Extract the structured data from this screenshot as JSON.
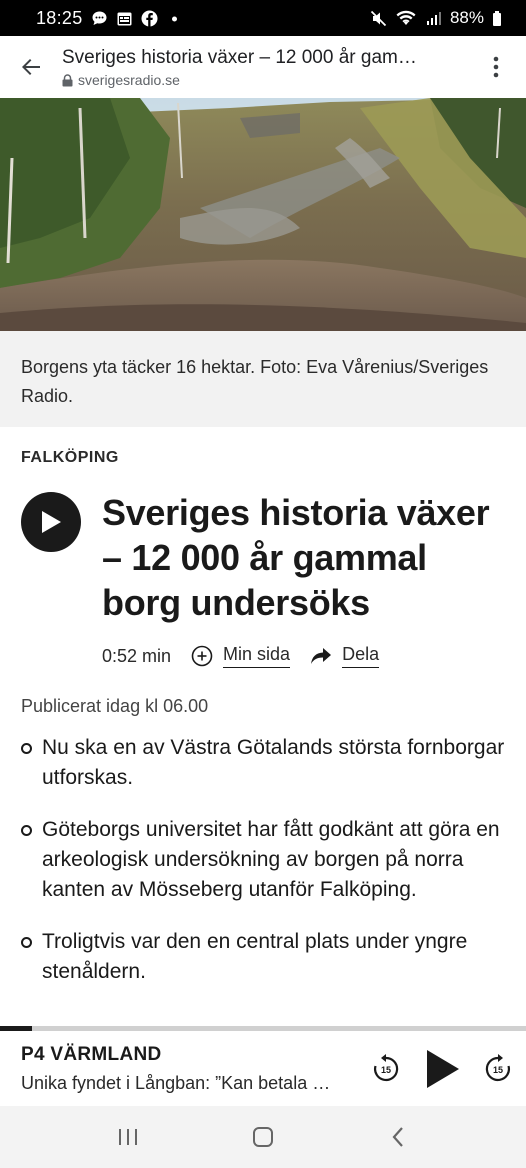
{
  "status_bar": {
    "time": "18:25",
    "battery": "88%",
    "icons": [
      "chat-bubble-icon",
      "calendar-icon",
      "facebook-icon",
      "dot-icon",
      "mute-icon",
      "wifi-icon",
      "signal-icon",
      "battery-icon"
    ]
  },
  "browser": {
    "title": "Sveriges historia växer – 12 000 år gam…",
    "domain": "sverigesradio.se"
  },
  "article": {
    "image_caption": "Borgens yta täcker 16 hektar. Foto: Eva Vårenius/Sveriges Radio.",
    "category": "FALKÖPING",
    "headline": "Sveriges historia växer – 12 000 år gammal borg undersöks",
    "duration": "0:52 min",
    "my_page_label": "Min sida",
    "share_label": "Dela",
    "published": "Publicerat idag kl 06.00",
    "bullets": [
      "Nu ska en av Västra Götalands största fornborgar utforskas.",
      "Göteborgs universitet har fått godkänt att göra en arkeologisk undersökning av borgen på norra kanten av Mösseberg utanför Falköping.",
      "Troligtvis var den en central plats under yngre stenåldern."
    ]
  },
  "player": {
    "channel": "P4 VÄRMLAND",
    "episode": "Unika fyndet i Långban: ”Kan betala …",
    "skip_back_seconds": "15",
    "skip_forward_seconds": "15",
    "progress": 0.06
  },
  "colors": {
    "caption_bg": "#f2f2f2",
    "text": "#1a1a1a",
    "navbar_bg": "#f3f3f3"
  }
}
